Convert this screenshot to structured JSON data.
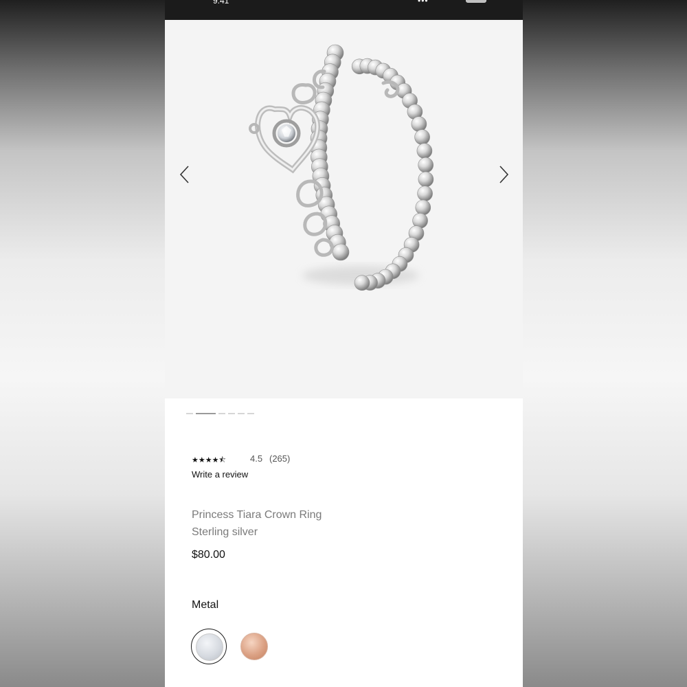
{
  "status_bar": {
    "time": "9:41",
    "signal": "••• "
  },
  "gallery": {
    "prev_icon": "chevron-left-icon",
    "next_icon": "chevron-right-icon",
    "image_count": 6,
    "active_index": 1
  },
  "product": {
    "rating_value": "4.5",
    "rating": 4.5,
    "review_count": "(265)",
    "write_review": "Write a review",
    "name": "Princess Tiara Crown Ring",
    "material": "Sterling silver",
    "price": "$80.00"
  },
  "metal": {
    "label": "Metal",
    "options": [
      {
        "name": "silver",
        "color": "#d7dbe1",
        "selected": true
      },
      {
        "name": "rose gold",
        "color": "#dba184",
        "selected": false
      }
    ]
  },
  "colors": {
    "status_bar": "#1b1b1b",
    "gallery_bg": "#f4f4f4",
    "text_primary": "#111111",
    "text_secondary": "#7a7a7a"
  }
}
